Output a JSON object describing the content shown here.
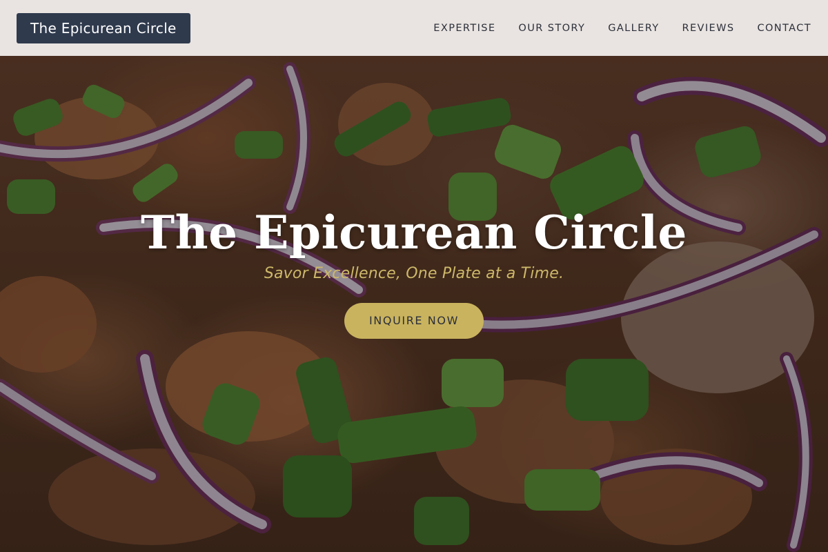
{
  "header": {
    "brand": "The Epicurean Circle",
    "nav": [
      {
        "label": "EXPERTISE"
      },
      {
        "label": "OUR STORY"
      },
      {
        "label": "GALLERY"
      },
      {
        "label": "REVIEWS"
      },
      {
        "label": "CONTACT"
      }
    ]
  },
  "hero": {
    "title": "The Epicurean Circle",
    "tagline": "Savor Excellence, One Plate at a Time.",
    "cta_label": "INQUIRE NOW",
    "background": "food-photo-onions-scallions"
  },
  "colors": {
    "header_bg": "#f5f2f0",
    "brand_bg": "#2f3a4d",
    "accent_gold": "#c9b35e",
    "tagline": "#cdb86a",
    "nav_text": "#2c2f3a"
  }
}
